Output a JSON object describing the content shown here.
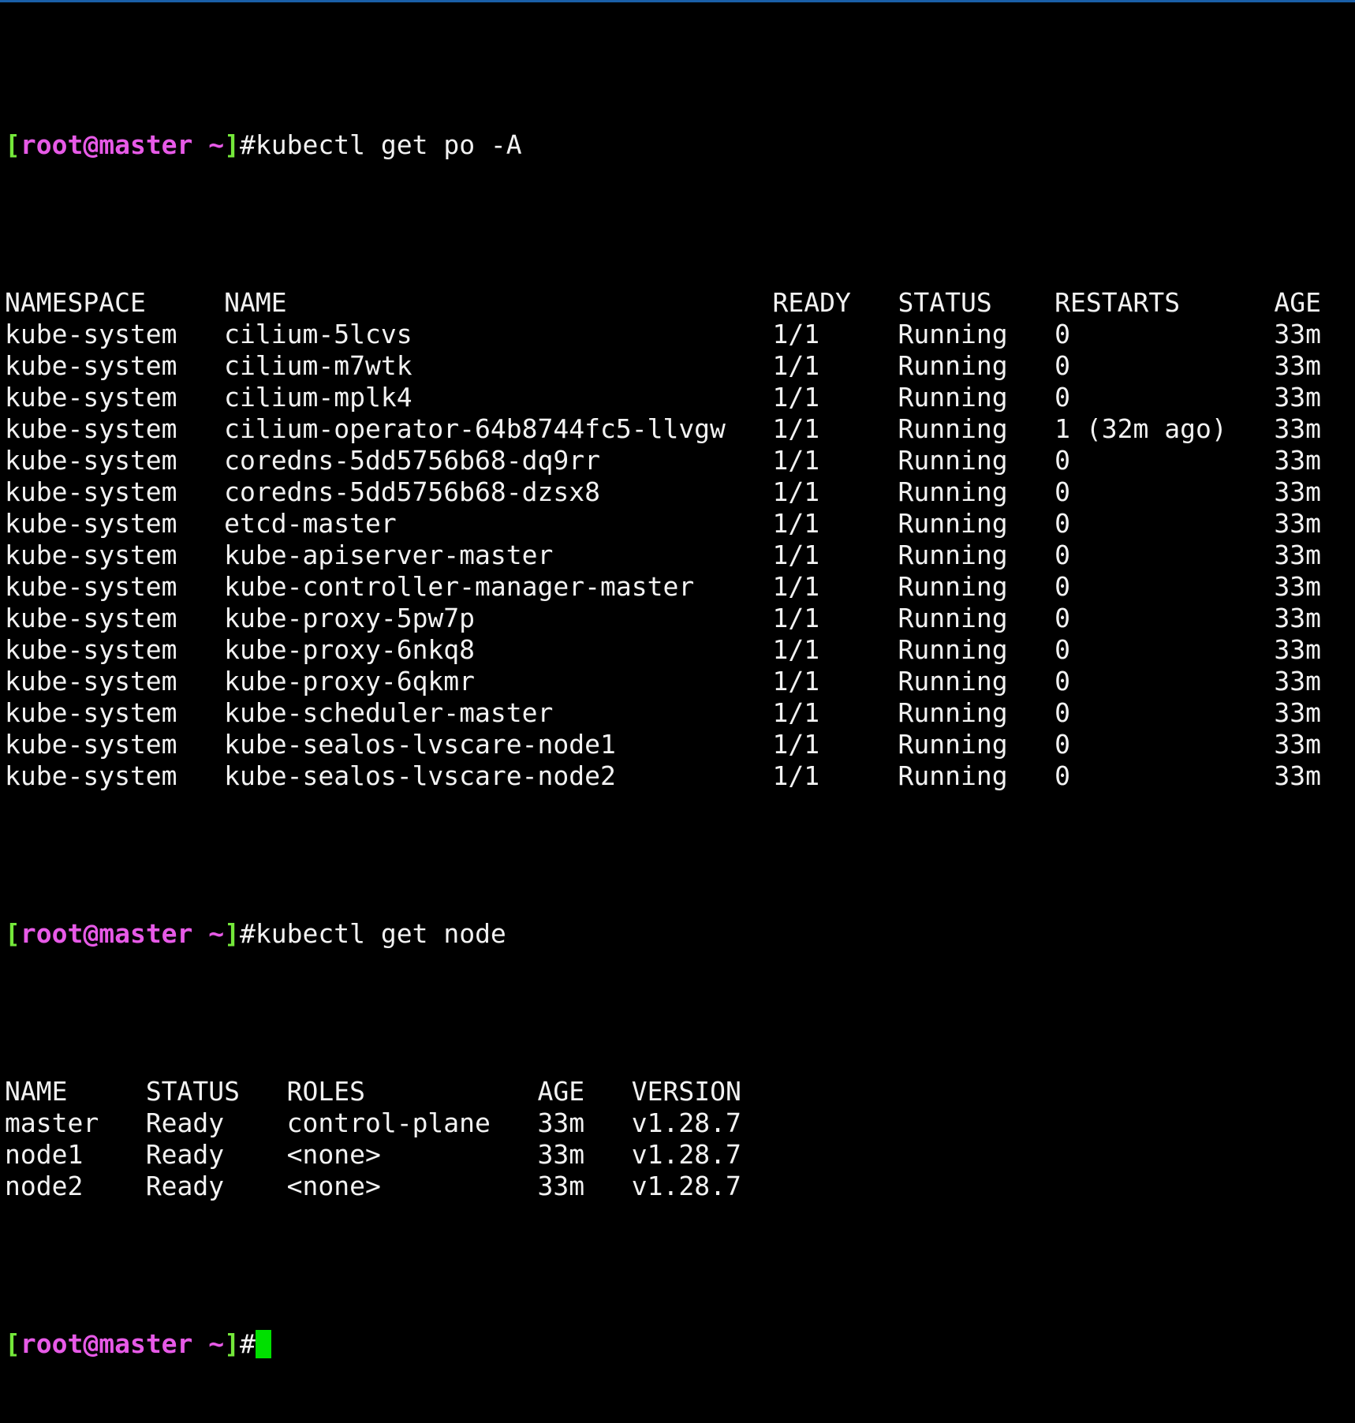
{
  "prompt": {
    "open_bracket": "[",
    "user_host": "root@master",
    "dir": "~",
    "close_bracket": "]",
    "hash": "#"
  },
  "commands": {
    "get_pods": "kubectl get po -A",
    "get_nodes": "kubectl get node"
  },
  "pods_table": {
    "headers": [
      "NAMESPACE",
      "NAME",
      "READY",
      "STATUS",
      "RESTARTS",
      "AGE"
    ],
    "rows": [
      [
        "kube-system",
        "cilium-5lcvs",
        "1/1",
        "Running",
        "0",
        "33m"
      ],
      [
        "kube-system",
        "cilium-m7wtk",
        "1/1",
        "Running",
        "0",
        "33m"
      ],
      [
        "kube-system",
        "cilium-mplk4",
        "1/1",
        "Running",
        "0",
        "33m"
      ],
      [
        "kube-system",
        "cilium-operator-64b8744fc5-llvgw",
        "1/1",
        "Running",
        "1 (32m ago)",
        "33m"
      ],
      [
        "kube-system",
        "coredns-5dd5756b68-dq9rr",
        "1/1",
        "Running",
        "0",
        "33m"
      ],
      [
        "kube-system",
        "coredns-5dd5756b68-dzsx8",
        "1/1",
        "Running",
        "0",
        "33m"
      ],
      [
        "kube-system",
        "etcd-master",
        "1/1",
        "Running",
        "0",
        "33m"
      ],
      [
        "kube-system",
        "kube-apiserver-master",
        "1/1",
        "Running",
        "0",
        "33m"
      ],
      [
        "kube-system",
        "kube-controller-manager-master",
        "1/1",
        "Running",
        "0",
        "33m"
      ],
      [
        "kube-system",
        "kube-proxy-5pw7p",
        "1/1",
        "Running",
        "0",
        "33m"
      ],
      [
        "kube-system",
        "kube-proxy-6nkq8",
        "1/1",
        "Running",
        "0",
        "33m"
      ],
      [
        "kube-system",
        "kube-proxy-6qkmr",
        "1/1",
        "Running",
        "0",
        "33m"
      ],
      [
        "kube-system",
        "kube-scheduler-master",
        "1/1",
        "Running",
        "0",
        "33m"
      ],
      [
        "kube-system",
        "kube-sealos-lvscare-node1",
        "1/1",
        "Running",
        "0",
        "33m"
      ],
      [
        "kube-system",
        "kube-sealos-lvscare-node2",
        "1/1",
        "Running",
        "0",
        "33m"
      ]
    ]
  },
  "nodes_table": {
    "headers": [
      "NAME",
      "STATUS",
      "ROLES",
      "AGE",
      "VERSION"
    ],
    "rows": [
      [
        "master",
        "Ready",
        "control-plane",
        "33m",
        "v1.28.7"
      ],
      [
        "node1",
        "Ready",
        "<none>",
        "33m",
        "v1.28.7"
      ],
      [
        "node2",
        "Ready",
        "<none>",
        "33m",
        "v1.28.7"
      ]
    ]
  },
  "colors": {
    "background": "#000000",
    "text": "#f2f2f2",
    "bracket": "#74e83a",
    "user_host": "#e75ae7",
    "cursor": "#00e000"
  }
}
